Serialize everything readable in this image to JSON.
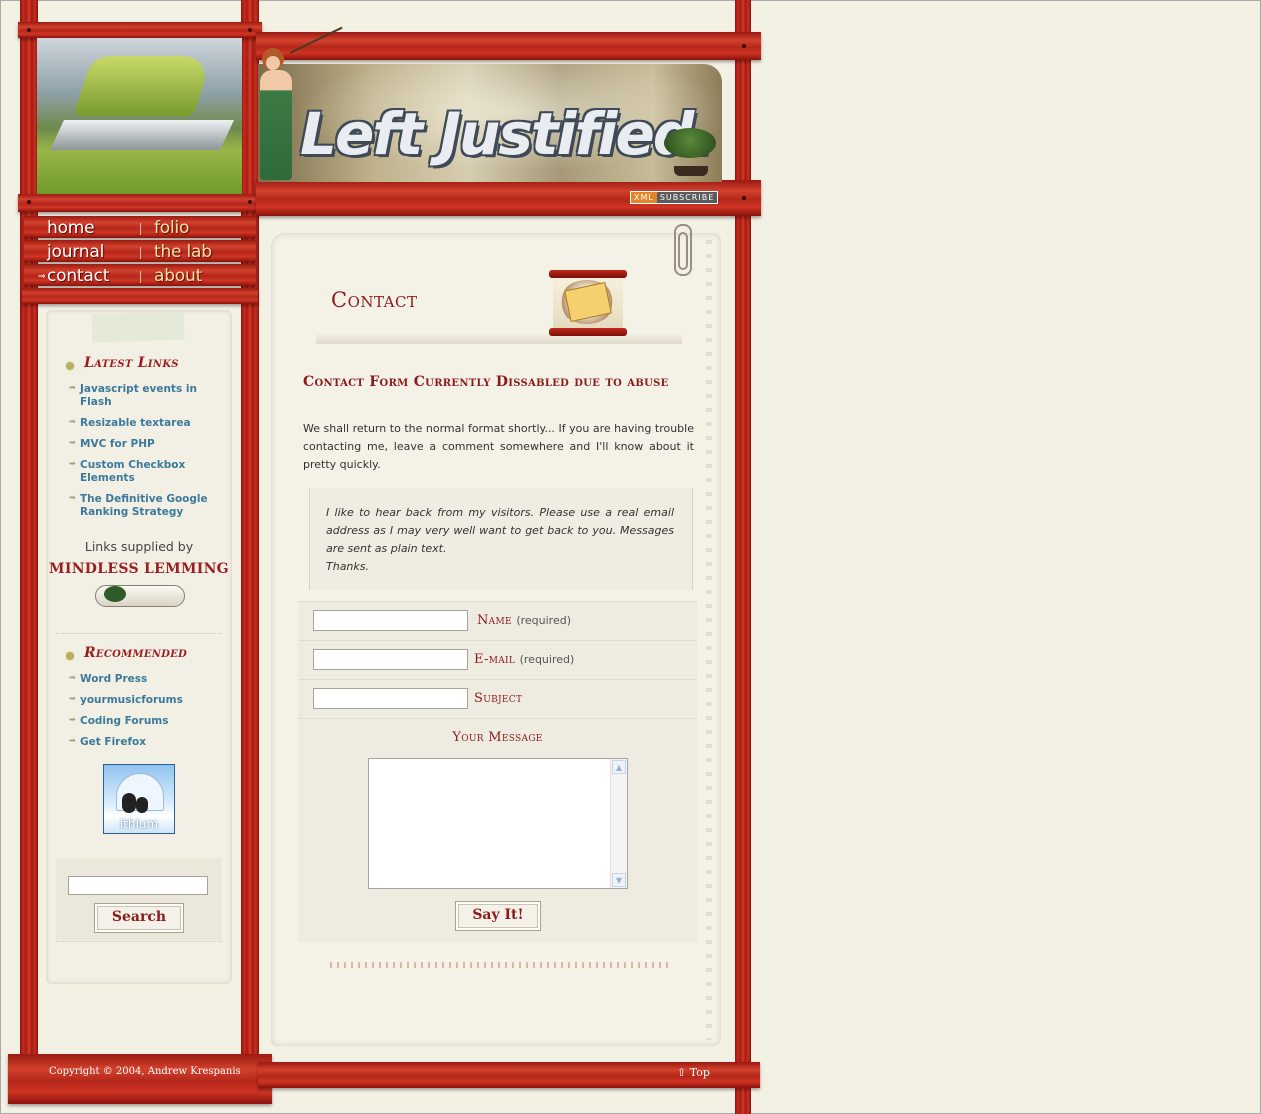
{
  "site": {
    "logo_text": "Left Justified.",
    "xml_badge": {
      "left": "XML",
      "right": "SUBSCRIBE"
    }
  },
  "nav": {
    "items": [
      {
        "label": "home"
      },
      {
        "label": "folio"
      },
      {
        "label": "journal"
      },
      {
        "label": "the lab"
      },
      {
        "label": "contact"
      },
      {
        "label": "about"
      }
    ],
    "active": "contact"
  },
  "sidebar": {
    "latest_links": {
      "heading": "Latest Links",
      "items": [
        "Javascript events in Flash",
        "Resizable textarea",
        "MVC for PHP",
        "Custom Checkbox Elements",
        "The Definitive Google Ranking Strategy"
      ],
      "supplied_by": "Links supplied by",
      "supplier": "MINDLESS LEMMING"
    },
    "recommended": {
      "heading": "Recommended",
      "items": [
        "Word Press",
        "yourmusicforums",
        "Coding Forums",
        "Get Firefox"
      ]
    },
    "ithium_label": "ithium",
    "search": {
      "value": "",
      "button_label": "Search"
    }
  },
  "main": {
    "title": "Contact",
    "notice": "Contact Form Currently Dissabled due to abuse",
    "intro": "We shall return to the normal format shortly... If you are having trouble contacting me, leave a comment somewhere and I'll know about it pretty quickly.",
    "quote": "I like to hear back from my visitors. Please use a real email address as I may very well want to get back to you. Messages are sent as plain text.",
    "quote_sign": "Thanks.",
    "form": {
      "name_label": "Name",
      "name_req": "(required)",
      "email_label": "E-mail",
      "email_req": "(required)",
      "subject_label": "Subject",
      "message_label": "Your Message",
      "submit_label": "Say It!",
      "name_value": "",
      "email_value": "",
      "subject_value": ""
    }
  },
  "footer": {
    "copyright": "Copyright © 2004, Andrew Krespanis",
    "top_link": "Top"
  },
  "colors": {
    "wood": "#b3261a",
    "accent_red": "#8b1b1b",
    "link_blue": "#3b7a9c",
    "paper": "#f4f1e6",
    "background": "#f3f0e4"
  }
}
